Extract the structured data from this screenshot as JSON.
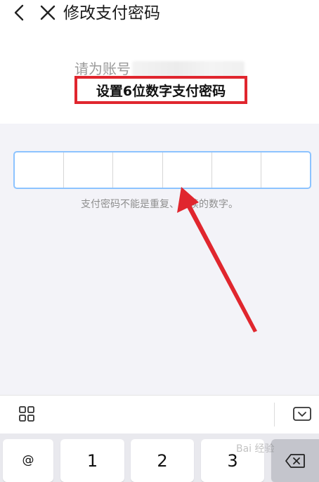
{
  "header": {
    "title": "修改支付密码"
  },
  "account": {
    "label": "请为账号"
  },
  "instruction": "设置6位数字支付密码",
  "hint": "支付密码不能是重复、连续的数字。",
  "keyboard": {
    "keys": {
      "at": "@",
      "one": "1",
      "two": "2",
      "three": "3"
    }
  },
  "watermark": "Bai 经验",
  "colors": {
    "highlight": "#e0262e",
    "arrow": "#e0262e",
    "pin_border": "#8cc3ff",
    "background_gray": "#f3f3f8"
  }
}
